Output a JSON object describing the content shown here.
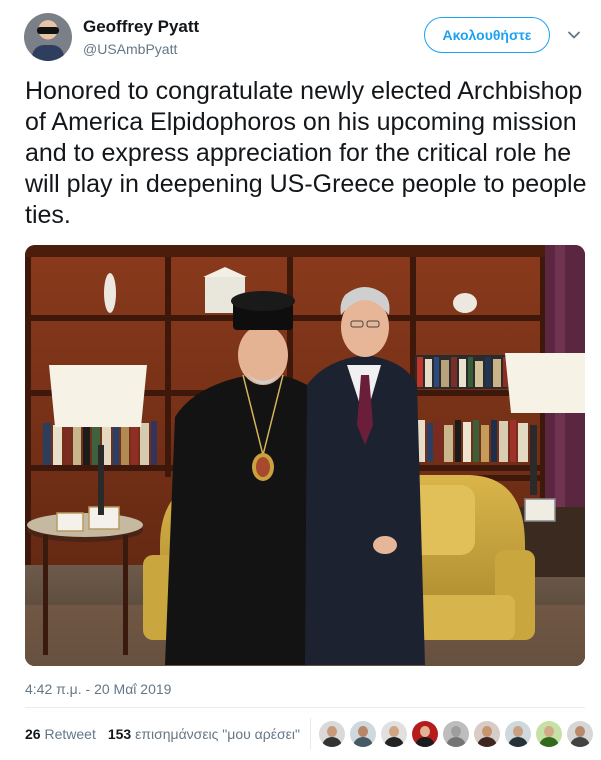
{
  "author": {
    "name": "Geoffrey Pyatt",
    "handle": "@USAmbPyatt"
  },
  "follow_button": {
    "label": "Ακολουθήστε"
  },
  "tweet": {
    "text": "Honored to congratulate newly elected Archbishop of America Elpidophoros on his upcoming mission and to express appreciation for the critical role he will play in deepening US-Greece people to people ties.",
    "timestamp": "4:42 π.μ. - 20 Μαΐ 2019"
  },
  "stats": {
    "retweet_count": "26",
    "retweet_label": "Retweet",
    "like_count": "153",
    "like_label": "επισημάνσεις \"μου αρέσει\""
  },
  "icons": {
    "menu": "chevron-down-icon"
  },
  "colors": {
    "accent": "#1da1f2",
    "text": "#14171a",
    "muted": "#657786",
    "divider": "#e6ecf0"
  },
  "likers": [
    {
      "bg": "#d9d9d9",
      "face": "#c79a7a",
      "body": "#333333"
    },
    {
      "bg": "#cfd8dc",
      "face": "#b8876a",
      "body": "#455a64"
    },
    {
      "bg": "#e0e0e0",
      "face": "#d2a582",
      "body": "#222222"
    },
    {
      "bg": "#b71c1c",
      "face": "#e0b494",
      "body": "#1b1b1b"
    },
    {
      "bg": "#bdbdbd",
      "face": "#9e9e9e",
      "body": "#757575"
    },
    {
      "bg": "#d7ccc8",
      "face": "#c8956f",
      "body": "#3e2723"
    },
    {
      "bg": "#cfd8dc",
      "face": "#caa083",
      "body": "#263238"
    },
    {
      "bg": "#c5e1a5",
      "face": "#d4a98a",
      "body": "#33691e"
    },
    {
      "bg": "#d6d6d6",
      "face": "#b9896b",
      "body": "#424242"
    }
  ]
}
